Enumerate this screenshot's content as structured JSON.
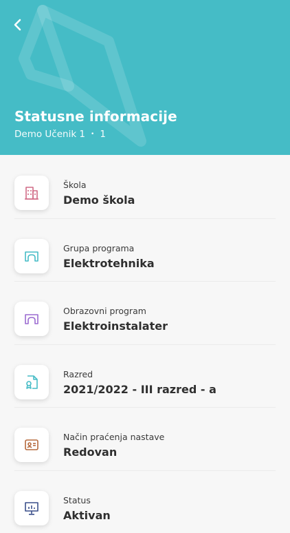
{
  "header": {
    "title": "Statusne informacije",
    "student": "Demo Učenik 1",
    "separator": "•",
    "number": "1",
    "background_color": "#45bcc6"
  },
  "items": [
    {
      "label": "Škola",
      "value": "Demo škola",
      "icon": "building-icon",
      "color": "#d16b86"
    },
    {
      "label": "Grupa programa",
      "value": "Elektrotehnika",
      "icon": "arch-icon",
      "color": "#45bcc6"
    },
    {
      "label": "Obrazovni program",
      "value": "Elektroinstalater",
      "icon": "arch-icon",
      "color": "#9b6bd1"
    },
    {
      "label": "Razred",
      "value": "2021/2022 - III razred - a",
      "icon": "certificate-icon",
      "color": "#45bcc6"
    },
    {
      "label": "Način praćenja nastave",
      "value": "Redovan",
      "icon": "id-card-icon",
      "color": "#b5683c"
    },
    {
      "label": "Status",
      "value": "Aktivan",
      "icon": "presentation-icon",
      "color": "#3a4f8a"
    }
  ]
}
